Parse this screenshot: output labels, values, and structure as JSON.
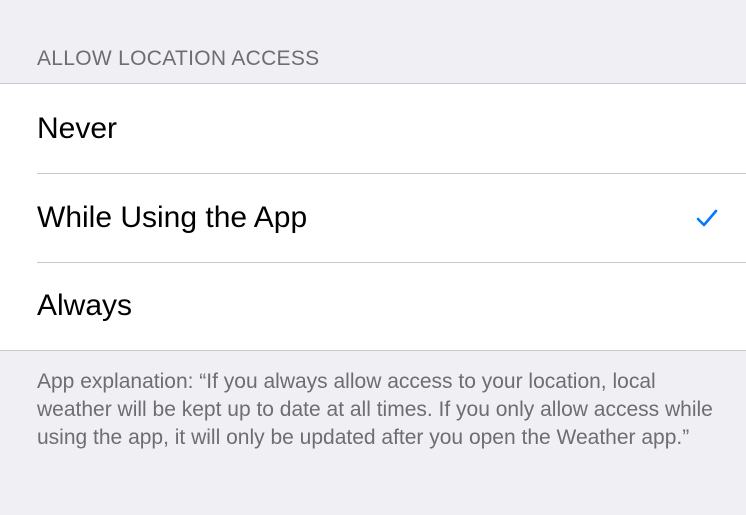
{
  "section": {
    "header": "ALLOW LOCATION ACCESS"
  },
  "options": [
    {
      "label": "Never",
      "selected": false
    },
    {
      "label": "While Using the App",
      "selected": true
    },
    {
      "label": "Always",
      "selected": false
    }
  ],
  "footer": {
    "text": "App explanation: “If you always allow access to your location, local weather will be kept up to date at all times. If you only allow access while using the app, it will only be updated after you open the Weather app.”"
  },
  "colors": {
    "background": "#efeff4",
    "accent": "#007aff",
    "separator": "#c8c7cc",
    "secondary_text": "#6d6d72"
  },
  "icons": {
    "selected_indicator": "checkmark-icon"
  }
}
